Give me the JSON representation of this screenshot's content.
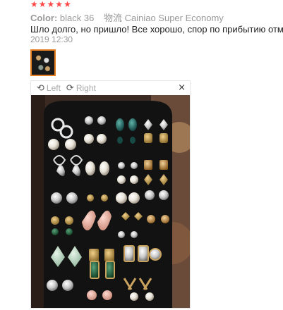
{
  "review": {
    "rating_stars": 5,
    "color_label": "Color:",
    "color_value": "black 36",
    "shipping_label": "物流",
    "shipping_value": "Cainiao Super Economy",
    "text": "Шло долго, но пришло! Все хорошо, спор по прибытию отме",
    "date": "2019 12:30"
  },
  "viewer": {
    "rotate_left_label": "Left",
    "rotate_right_label": "Right",
    "close_glyph": "×",
    "rotate_left_glyph": "⟲",
    "rotate_right_glyph": "⟳"
  },
  "icons": {
    "star": "★"
  },
  "colors": {
    "star": "#ff4747",
    "thumb_border": "#e67e22",
    "display_board": "#121212"
  }
}
